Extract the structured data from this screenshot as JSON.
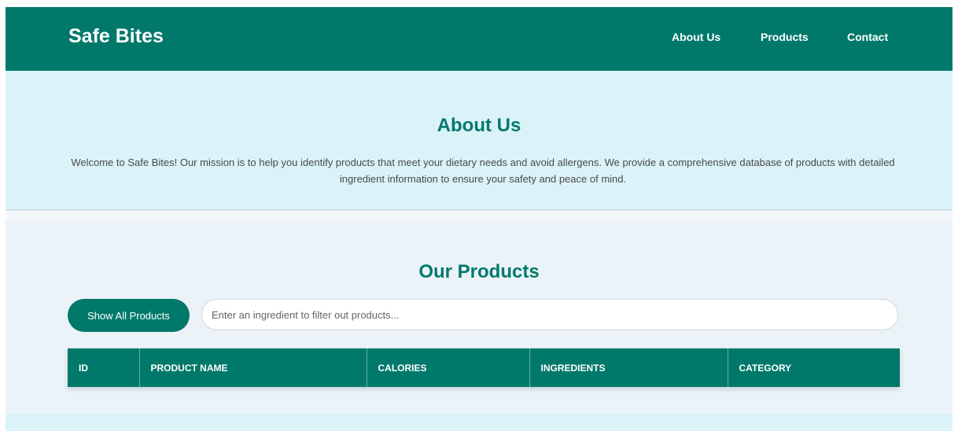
{
  "header": {
    "brand": "Safe Bites",
    "nav": {
      "about": "About Us",
      "products": "Products",
      "contact": "Contact"
    }
  },
  "about": {
    "title": "About Us",
    "text": "Welcome to Safe Bites! Our mission is to help you identify products that meet your dietary needs and avoid allergens. We provide a comprehensive database of products with detailed ingredient information to ensure your safety and peace of mind."
  },
  "products": {
    "title": "Our Products",
    "show_all_label": "Show All Products",
    "search": {
      "placeholder": "Enter an ingredient to filter out products...",
      "value": ""
    },
    "table": {
      "columns": [
        "ID",
        "PRODUCT NAME",
        "CALORIES",
        "INGREDIENTS",
        "CATEGORY"
      ],
      "rows": []
    }
  },
  "colors": {
    "primary": "#00796b",
    "about_bg": "#dbf3f8",
    "products_bg": "#ebf3f9",
    "text": "#4a4a4a",
    "white": "#ffffff"
  }
}
